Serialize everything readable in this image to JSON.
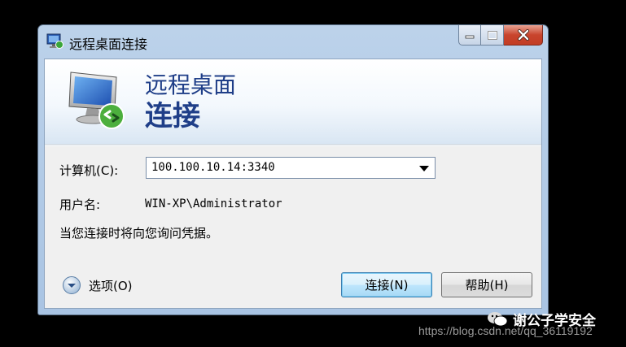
{
  "window": {
    "title": "远程桌面连接"
  },
  "banner": {
    "line1": "远程桌面",
    "line2": "连接"
  },
  "form": {
    "computer_label": "计算机(C):",
    "computer_value": "100.100.10.14:3340",
    "username_label": "用户名:",
    "username_value": "WIN-XP\\Administrator",
    "info_text": "当您连接时将向您询问凭据。"
  },
  "footer": {
    "options_label": "选项(O)",
    "connect_label": "连接(N)",
    "help_label": "帮助(H)"
  },
  "watermark": {
    "brand": "谢公子学安全",
    "url": "https://blog.csdn.net/qq_36119192"
  },
  "icons": {
    "title": "remote-desktop-icon",
    "banner": "monitor-connect-icon",
    "options": "chevron-down-circle-icon"
  },
  "colors": {
    "banner_text": "#1f3e88",
    "close_button": "#c8442d"
  }
}
